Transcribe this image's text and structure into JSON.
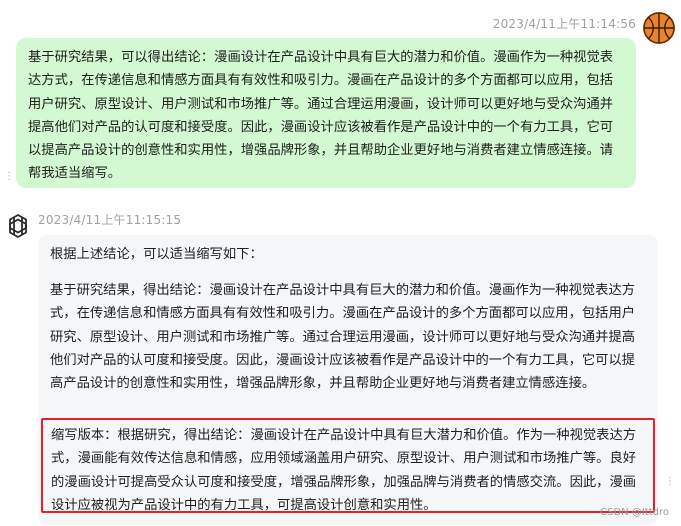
{
  "user_message": {
    "timestamp": "2023/4/11上午11:14:56",
    "avatar_icon": "basketball-icon",
    "bubble_color": "#d2f9d1",
    "text": "基于研究结果，可以得出结论：漫画设计在产品设计中具有巨大的潜力和价值。漫画作为一种视觉表达方式，在传递信息和情感方面具有有效性和吸引力。漫画在产品设计的多个方面都可以应用，包括用户研究、原型设计、用户测试和市场推广等。通过合理运用漫画，设计师可以更好地与受众沟通并提高他们对产品的认可度和接受度。因此，漫画设计应该被看作是产品设计中的一个有力工具，它可以提高产品设计的创意性和实用性，增强品牌形象，并且帮助企业更好地与消费者建立情感连接。请帮我适当缩写。"
  },
  "assistant_message": {
    "timestamp": "2023/4/11上午11:15:15",
    "avatar_icon": "openai-logo-icon",
    "bubble_color": "#f4f6f8",
    "intro": "根据上述结论，可以适当缩写如下：",
    "paragraph": "基于研究结果，得出结论：漫画设计在产品设计中具有巨大的潜力和价值。漫画作为一种视觉表达方式，在传递信息和情感方面具有有效性和吸引力。漫画在产品设计的多个方面都可以应用，包括用户研究、原型设计、用户测试和市场推广等。通过合理运用漫画，设计师可以更好地与受众沟通并提高他们对产品的认可度和接受度。因此，漫画设计应该被看作是产品设计中的一个有力工具，它可以提高产品设计的创意性和实用性，增强品牌形象，并且帮助企业更好地与消费者建立情感连接。",
    "short_version": "缩写版本：根据研究，得出结论：漫画设计在产品设计中具有巨大潜力和价值。作为一种视觉表达方式，漫画能有效传达信息和情感，应用领域涵盖用户研究、原型设计、用户测试和市场推广等。良好的漫画设计可提高受众认可度和接受度，增强品牌形象，加强品牌与消费者的情感交流。因此，漫画设计应被视为产品设计中的有力工具，可提高设计创意和实用性。",
    "highlight_color": "#e6202a"
  },
  "more_icon": "more-vertical-icon",
  "watermark": "CSDN @Ittdro"
}
